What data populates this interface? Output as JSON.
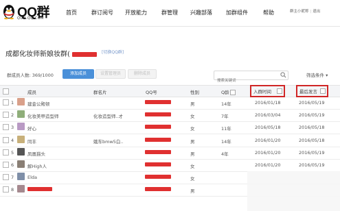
{
  "header": {
    "logo_text": "QQ群",
    "logo_sub": "QUN.QQ.COM",
    "nav": [
      "首页",
      "群订阅号",
      "开放能力",
      "群管理",
      "兴趣部落",
      "加群组件",
      "帮助"
    ],
    "user_name": "群主小昵称",
    "logout": "退出"
  },
  "group": {
    "title": "成都化妆师新娘妆群(",
    "switch_label": "[切换QQ群]"
  },
  "toolbar": {
    "member_count": "群成员人数: 369/1000",
    "add_member": "添加成员",
    "set_admin": "设置管理员",
    "delete_member": "删除成员",
    "search_placeholder": "搜索关键词",
    "filter": "筛选条件 ▾"
  },
  "table": {
    "columns": [
      "成员",
      "群名片",
      "QQ号",
      "性别",
      "Q龄",
      "入群时间",
      "最后发言"
    ],
    "rows": [
      {
        "num": "1",
        "name": "建金公殿顿",
        "card": "",
        "gender": "男",
        "qage": "14年",
        "join": "2016/01/18",
        "last": "2016/05/19",
        "avatar": "#d9a08a"
      },
      {
        "num": "2",
        "name": "化妆美甲造型师",
        "card": "化妆造型师..才",
        "gender": "女",
        "qage": "7年",
        "join": "2016/03/04",
        "last": "2016/05/19",
        "avatar": "#8fae7a"
      },
      {
        "num": "3",
        "name": "好心",
        "card": "",
        "gender": "女",
        "qage": "11年",
        "join": "2016/05/18",
        "last": "2016/05/18",
        "avatar": "#b99ac4"
      },
      {
        "num": "4",
        "name": "同丰",
        "card": "娥车bmw5白..",
        "gender": "男",
        "qage": "14年",
        "join": "2016/01/20",
        "last": "2016/05/18",
        "avatar": "#c8b07a"
      },
      {
        "num": "5",
        "name": "凤凰猫头",
        "card": "",
        "gender": "男",
        "qage": "4年",
        "join": "2016/01/20",
        "last": "2016/05/19",
        "avatar": "#555555"
      },
      {
        "num": "6",
        "name": "解High人",
        "card": "",
        "gender": "女",
        "qage": "",
        "join": "2016/01/20",
        "last": "2016/05/19",
        "avatar": "#8a7f75"
      },
      {
        "num": "7",
        "name": "Elda",
        "card": "",
        "gender": "女",
        "qage": "",
        "join": "",
        "last": "",
        "avatar": "#7f8fa8"
      },
      {
        "num": "8",
        "name": "",
        "card": "",
        "gender": "男",
        "qage": "",
        "join": "",
        "last": "",
        "avatar": "#a5898f"
      }
    ]
  },
  "colors": {
    "accent": "#4a90d9",
    "highlight": "#d02525",
    "redact": "#e03030"
  }
}
